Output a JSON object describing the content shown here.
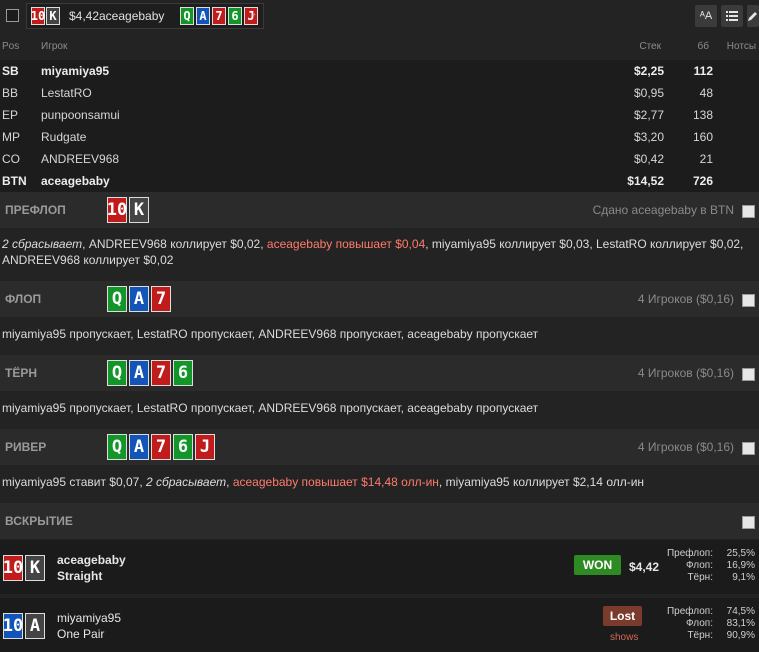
{
  "header": {
    "hand_amount": "$4,42",
    "hand_player": "aceagebaby",
    "hero_cards": [
      {
        "rank": "10",
        "suit": "r"
      },
      {
        "rank": "K",
        "suit": "k"
      }
    ],
    "board_cards": [
      {
        "rank": "Q",
        "suit": "g"
      },
      {
        "rank": "A",
        "suit": "b"
      },
      {
        "rank": "7",
        "suit": "r"
      },
      {
        "rank": "6",
        "suit": "g"
      },
      {
        "rank": "J",
        "suit": "r"
      }
    ],
    "font_btn": "ᴬA",
    "list_icon": "list-icon",
    "edit_icon": "pencil-icon"
  },
  "table": {
    "headers": {
      "pos": "Pos",
      "player": "Игрок",
      "stack": "Стек",
      "bb": "бб",
      "notes": "Нотсы"
    },
    "rows": [
      {
        "pos": "SB",
        "name": "miyamiya95",
        "stack": "$2,25",
        "bb": "112",
        "bold": true
      },
      {
        "pos": "BB",
        "name": "LestatRO",
        "stack": "$0,95",
        "bb": "48",
        "bold": false
      },
      {
        "pos": "EP",
        "name": "punpoonsamui",
        "stack": "$2,77",
        "bb": "138",
        "bold": false
      },
      {
        "pos": "MP",
        "name": "Rudgate",
        "stack": "$3,20",
        "bb": "160",
        "bold": false
      },
      {
        "pos": "CO",
        "name": "ANDREEV968",
        "stack": "$0,42",
        "bb": "21",
        "bold": false
      },
      {
        "pos": "BTN",
        "name": "aceagebaby",
        "stack": "$14,52",
        "bb": "726",
        "bold": true
      }
    ]
  },
  "streets": {
    "preflop": {
      "title": "ПРЕФЛОП",
      "right": "Сдано aceagebaby в BTN"
    },
    "flop": {
      "title": "ФЛОП",
      "right": "4 Игроков ($0,16)"
    },
    "turn": {
      "title": "ТЁРН",
      "right": "4 Игроков ($0,16)"
    },
    "river": {
      "title": "РИВЕР",
      "right": "4 Игроков ($0,16)"
    },
    "showdown": {
      "title": "ВСКРЫТИЕ"
    }
  },
  "actions": {
    "preflop": {
      "a1": "2 сбрасывает",
      "a2": ", ANDREEV968 коллирует $0,02, ",
      "a3": "aceagebaby повышает $0,04",
      "a4": ", miyamiya95 коллирует $0,03, LestatRO коллирует $0,02,",
      "a5": "ANDREEV968 коллирует $0,02"
    },
    "flop": "miyamiya95 пропускает, LestatRO пропускает, ANDREEV968 пропускает, aceagebaby пропускает",
    "turn": "miyamiya95 пропускает, LestatRO пропускает, ANDREEV968 пропускает, aceagebaby пропускает",
    "river": {
      "a1": "miyamiya95 ставит $0,07, ",
      "a2": "2 сбрасывает",
      "a3": ", ",
      "a4": "aceagebaby повышает $14,48 олл-ин",
      "a5": ", miyamiya95 коллирует $2,14 олл-ин"
    }
  },
  "showdown": {
    "winner": {
      "name": "aceagebaby",
      "hand": "Straight",
      "badge": "WON",
      "amount": "$4,42",
      "cards": [
        {
          "rank": "10",
          "suit": "r"
        },
        {
          "rank": "K",
          "suit": "k"
        }
      ],
      "equity": [
        {
          "label": "Префлоп:",
          "value": "25,5%"
        },
        {
          "label": "Флоп:",
          "value": "16,9%"
        },
        {
          "label": "Тёрн:",
          "value": "9,1%"
        }
      ]
    },
    "loser": {
      "name": "miyamiya95",
      "hand": "One Pair",
      "badge": "Lost",
      "sub": "shows",
      "cards": [
        {
          "rank": "10",
          "suit": "b"
        },
        {
          "rank": "A",
          "suit": "k"
        }
      ],
      "equity": [
        {
          "label": "Префлоп:",
          "value": "74,5%"
        },
        {
          "label": "Флоп:",
          "value": "83,1%"
        },
        {
          "label": "Тёрн:",
          "value": "90,9%"
        }
      ]
    }
  }
}
